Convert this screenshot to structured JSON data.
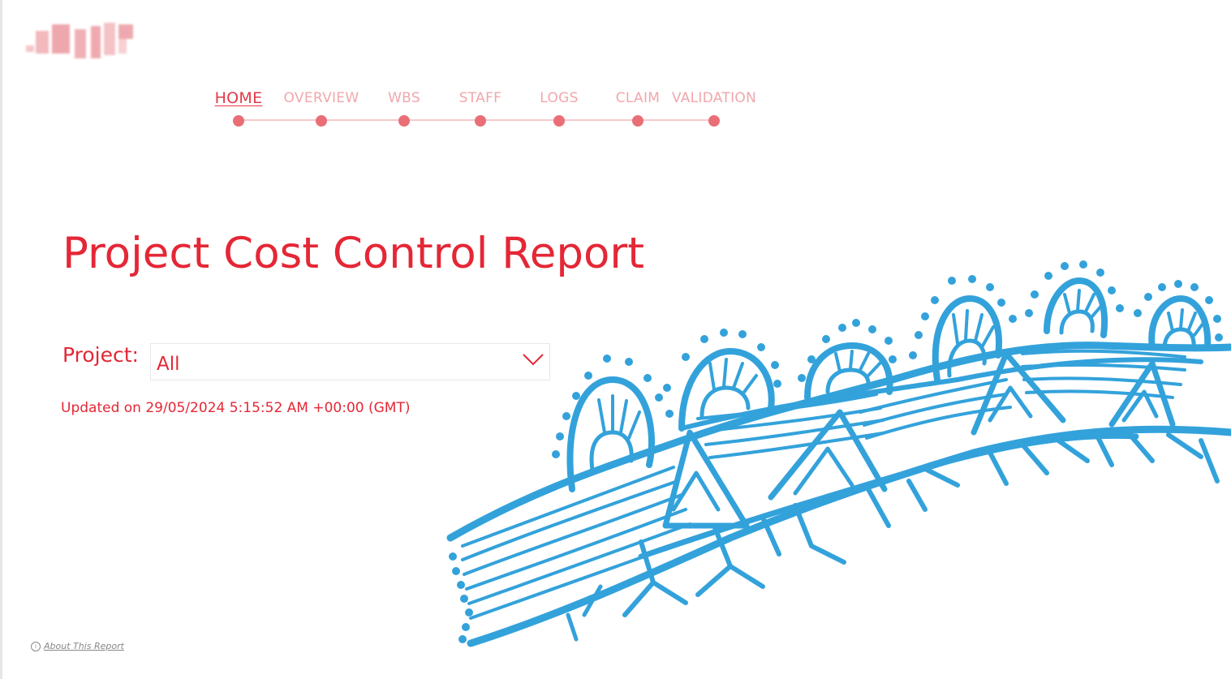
{
  "nav": {
    "items": [
      {
        "label": "HOME",
        "active": true
      },
      {
        "label": "OVERVIEW",
        "active": false
      },
      {
        "label": "WBS",
        "active": false
      },
      {
        "label": "STAFF",
        "active": false
      },
      {
        "label": "LOGS",
        "active": false
      },
      {
        "label": "CLAIM",
        "active": false
      },
      {
        "label": "VALIDATION",
        "active": false
      }
    ]
  },
  "report": {
    "title": "Project Cost Control Report",
    "project_label": "Project:",
    "project_value": "All",
    "updated_text": "Updated on 29/05/2024 5:15:52 AM +00:00 (GMT)"
  },
  "footer": {
    "about_label": "About This Report"
  },
  "colors": {
    "accent": "#e42736",
    "nav_inactive": "#f0a7ac",
    "nav_dot": "#ea6e76",
    "artwork": "#33a2db"
  },
  "icons": {
    "logo": "blurred-company-logo",
    "dropdown": "chevron-down-icon",
    "about": "info-icon"
  }
}
